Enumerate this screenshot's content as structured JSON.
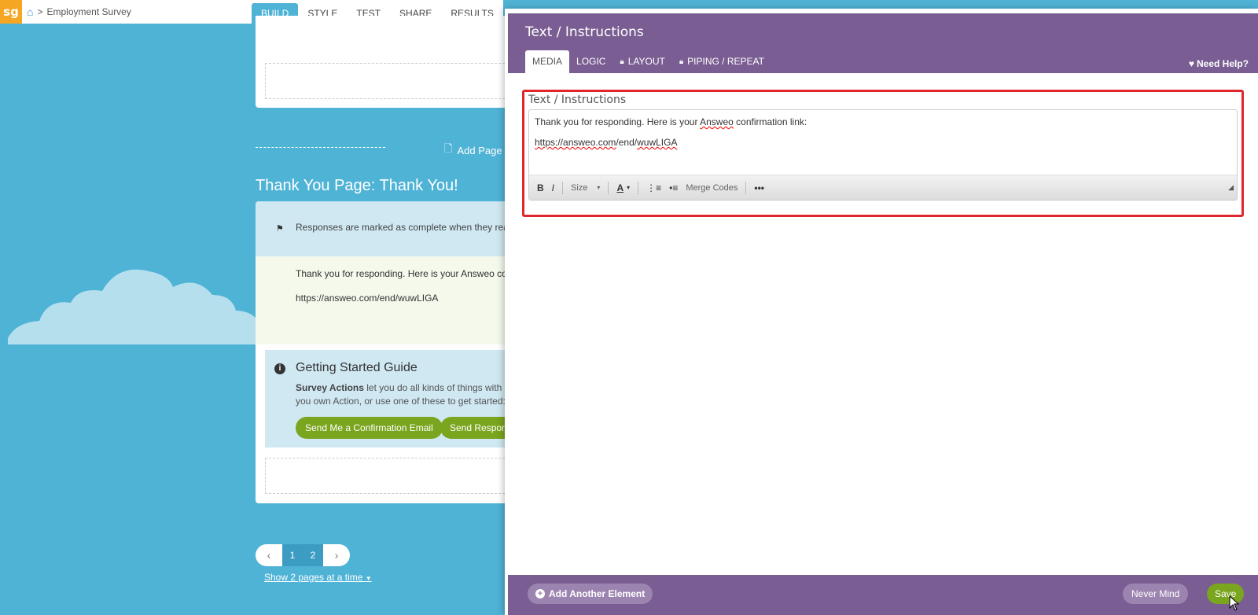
{
  "topbar": {
    "logo": "sg",
    "breadcrumb_sep": ">",
    "survey_name": "Employment Survey",
    "tabs": [
      {
        "label": "BUILD"
      },
      {
        "label": "STYLE"
      },
      {
        "label": "TEST"
      },
      {
        "label": "SHARE"
      },
      {
        "label": "RESULTS"
      },
      {
        "label": "T"
      }
    ]
  },
  "canvas": {
    "add_page": "Add Page",
    "thank_you_title": "Thank You Page: Thank You!",
    "complete_note": "Responses are marked as complete when they reach",
    "message_line1": "Thank you for responding. Here is your Answeo confi",
    "message_line2": "https://answeo.com/end/wuwLIGA",
    "guide": {
      "title": "Getting Started Guide",
      "text_bold": "Survey Actions",
      "text_rest": " let you do all kinds of things with you own Action, or use one of these to get started:",
      "btn_confirm": "Send Me a Confirmation Email",
      "btn_responses": "Send Respons"
    },
    "pager": {
      "page1": "1",
      "page2": "2",
      "show_pages": "Show 2 pages at a time"
    }
  },
  "modal": {
    "title": "Text / Instructions",
    "tabs": [
      {
        "label": "MEDIA"
      },
      {
        "label": "LOGIC"
      },
      {
        "label": "LAYOUT"
      },
      {
        "label": "PIPING / REPEAT"
      }
    ],
    "need_help": "Need Help?",
    "editor": {
      "label": "Text / Instructions",
      "line1_a": "Thank you for responding. Here is your ",
      "line1_b": "Answeo",
      "line1_c": " confirmation link:",
      "line2_a": "https://",
      "line2_b": "answeo.com",
      "line2_c": "/end/",
      "line2_d": "wuwLIGA",
      "toolbar": {
        "bold": "B",
        "italic": "I",
        "size": "Size",
        "font_color": "A",
        "merge_codes": "Merge Codes",
        "more": "•••"
      }
    },
    "footer": {
      "add_element": "Add Another Element",
      "never_mind": "Never Mind",
      "save": "Save"
    }
  }
}
